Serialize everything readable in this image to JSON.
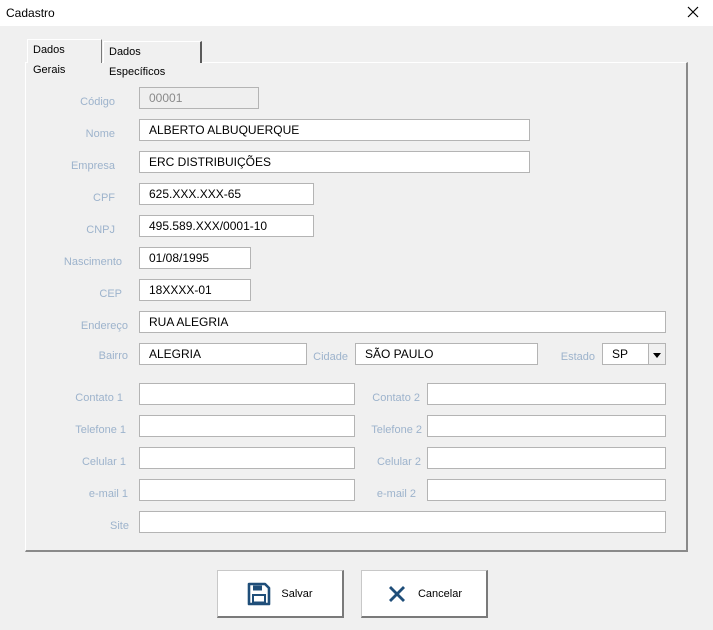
{
  "window": {
    "title": "Cadastro"
  },
  "tabs": [
    {
      "label": "Dados Gerais",
      "active": true
    },
    {
      "label": "Dados Específicos",
      "active": false
    }
  ],
  "form": {
    "codigo": {
      "label": "Código",
      "value": "00001"
    },
    "nome": {
      "label": "Nome",
      "value": "ALBERTO ALBUQUERQUE"
    },
    "empresa": {
      "label": "Empresa",
      "value": "ERC DISTRIBUIÇÕES"
    },
    "cpf": {
      "label": "CPF",
      "value": "625.XXX.XXX-65"
    },
    "cnpj": {
      "label": "CNPJ",
      "value": "495.589.XXX/0001-10"
    },
    "nascimento": {
      "label": "Nascimento",
      "value": "01/08/1995"
    },
    "cep": {
      "label": "CEP",
      "value": "18XXXX-01"
    },
    "endereco": {
      "label": "Endereço",
      "value": "RUA ALEGRIA"
    },
    "bairro": {
      "label": "Bairro",
      "value": "ALEGRIA"
    },
    "cidade": {
      "label": "Cidade",
      "value": "SÃO PAULO"
    },
    "estado": {
      "label": "Estado",
      "value": "SP"
    },
    "contato1": {
      "label": "Contato 1",
      "value": ""
    },
    "contato2": {
      "label": "Contato 2",
      "value": ""
    },
    "telefone1": {
      "label": "Telefone 1",
      "value": ""
    },
    "telefone2": {
      "label": "Telefone 2",
      "value": ""
    },
    "celular1": {
      "label": "Celular 1",
      "value": ""
    },
    "celular2": {
      "label": "Celular 2",
      "value": ""
    },
    "email1": {
      "label": "e-mail 1",
      "value": ""
    },
    "email2": {
      "label": "e-mail 2",
      "value": ""
    },
    "site": {
      "label": "Site",
      "value": ""
    }
  },
  "buttons": {
    "save": {
      "label": "Salvar",
      "icon": "save-icon"
    },
    "cancel": {
      "label": "Cancelar",
      "icon": "cancel-icon"
    }
  },
  "colors": {
    "label": "#9db3cc",
    "save_icon": "#1f4e79",
    "cancel_icon": "#1f4e79"
  }
}
